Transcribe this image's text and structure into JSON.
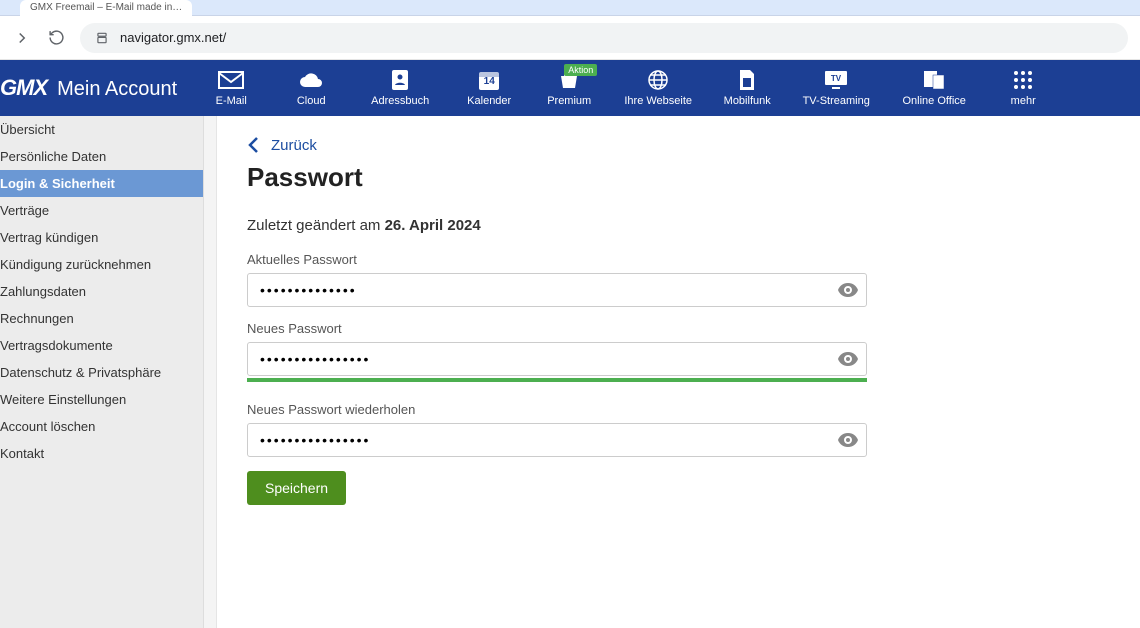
{
  "browser": {
    "tab_title": "GMX Freemail – E-Mail made in…",
    "url": "navigator.gmx.net/"
  },
  "topnav": {
    "logo": "GMX",
    "subtitle": "Mein Account",
    "items": [
      {
        "label": "E-Mail",
        "icon": "mail"
      },
      {
        "label": "Cloud",
        "icon": "cloud"
      },
      {
        "label": "Adressbuch",
        "icon": "addressbook"
      },
      {
        "label": "Kalender",
        "icon": "calendar",
        "day": "14"
      },
      {
        "label": "Premium",
        "icon": "premium",
        "badge": "Aktion"
      },
      {
        "label": "Ihre Webseite",
        "icon": "globe"
      },
      {
        "label": "Mobilfunk",
        "icon": "sim"
      },
      {
        "label": "TV-Streaming",
        "icon": "tv"
      },
      {
        "label": "Online Office",
        "icon": "office"
      },
      {
        "label": "mehr",
        "icon": "grid"
      }
    ]
  },
  "sidebar": {
    "items": [
      "Übersicht",
      "Persönliche Daten",
      "Login & Sicherheit",
      "Verträge",
      "Vertrag kündigen",
      "Kündigung zurücknehmen",
      "Zahlungsdaten",
      "Rechnungen",
      "Vertragsdokumente",
      "Datenschutz & Privatsphäre",
      "Weitere Einstellungen",
      "Account löschen",
      "Kontakt"
    ],
    "active_index": 2
  },
  "page": {
    "back_label": "Zurück",
    "title": "Passwort",
    "changed_prefix": "Zuletzt geändert am ",
    "changed_date": "26. April 2024",
    "fields": {
      "current": {
        "label": "Aktuelles Passwort",
        "value": "••••••••••••••"
      },
      "new": {
        "label": "Neues Passwort",
        "value": "••••••••••••••••"
      },
      "repeat": {
        "label": "Neues Passwort wiederholen",
        "value": "••••••••••••••••"
      }
    },
    "save_label": "Speichern"
  }
}
